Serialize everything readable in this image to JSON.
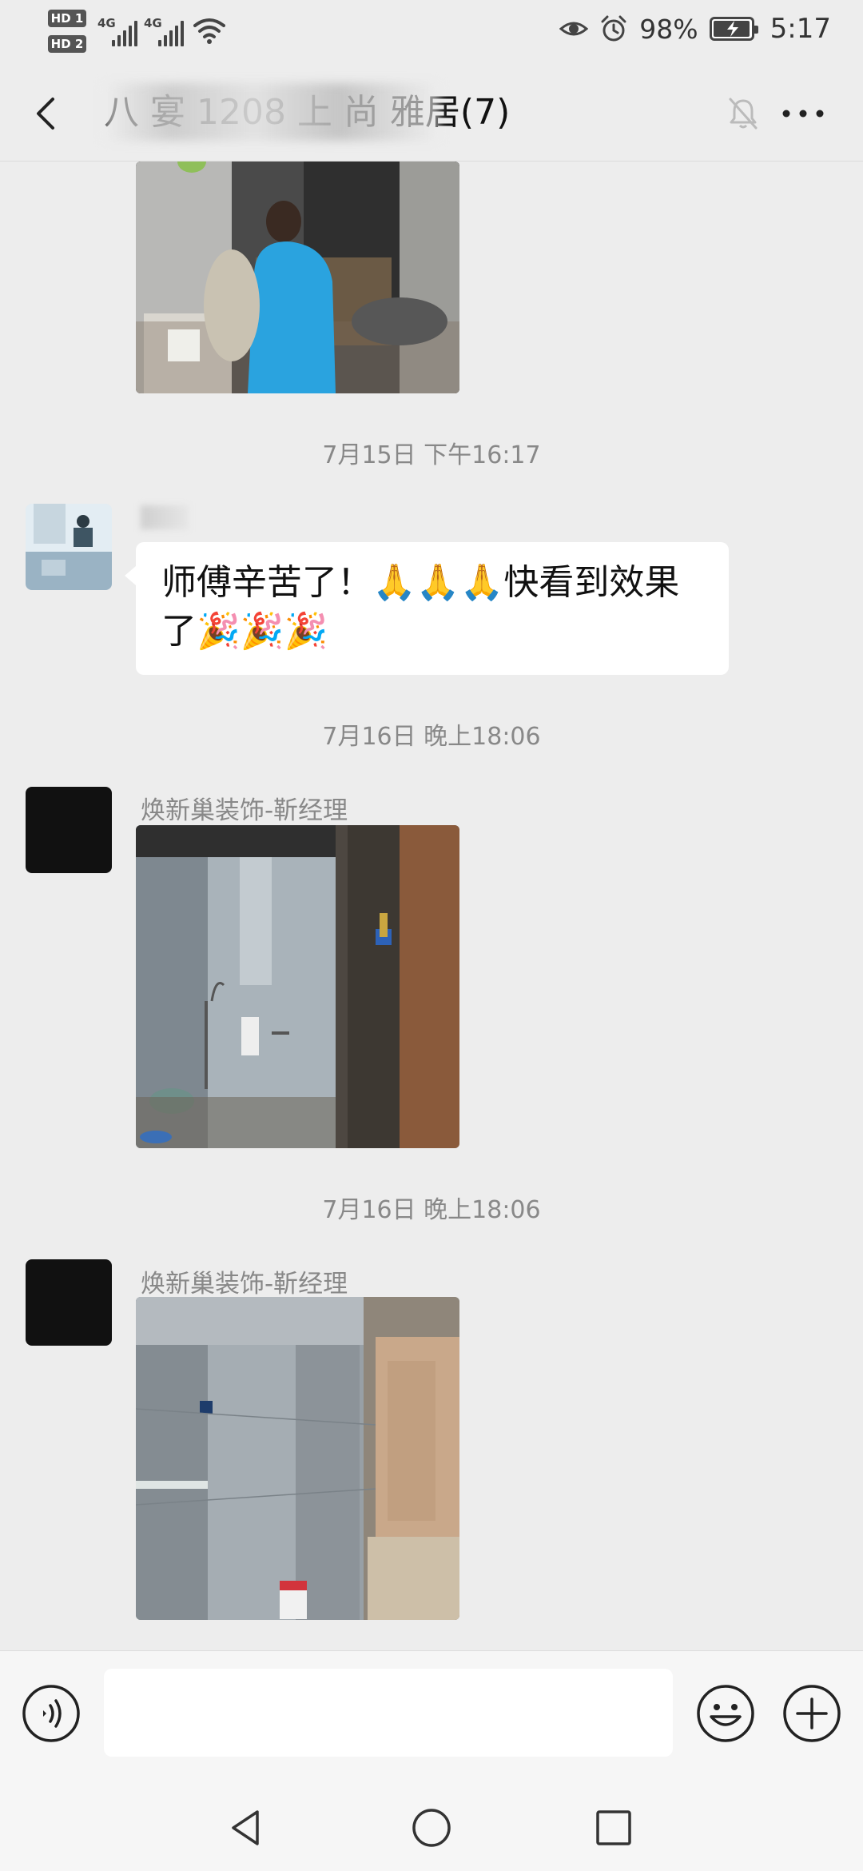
{
  "status_bar": {
    "hd1": "HD 1",
    "hd2": "HD 2",
    "net1": "4G",
    "net2": "4G",
    "battery_percent": "98%",
    "battery_level": 0.98,
    "time": "5:17",
    "icons": [
      "eye-icon",
      "alarm-icon",
      "battery-charging-icon",
      "wifi-icon",
      "signal-icon"
    ]
  },
  "header": {
    "title": "八 宴        1208 上 尚 雅居(7)",
    "icons": [
      "back-icon",
      "mute-bell-icon",
      "more-icon"
    ]
  },
  "messages": [
    {
      "type": "timestamp",
      "text": "7月15日 下午16:17"
    },
    {
      "type": "text",
      "sender": "",
      "text": "师傅辛苦了！🙏🙏🙏快看到效果了🎉🎉🎉"
    },
    {
      "type": "timestamp",
      "text": "7月16日 晚上18:06"
    },
    {
      "type": "image",
      "sender": "焕新巢装饰-靳经理"
    },
    {
      "type": "timestamp",
      "text": "7月16日 晚上18:06"
    },
    {
      "type": "image",
      "sender": "焕新巢装饰-靳经理"
    }
  ],
  "input_bar": {
    "placeholder": "",
    "icons": [
      "voice-icon",
      "emoji-icon",
      "plus-icon"
    ]
  },
  "nav_bar": {
    "icons": [
      "nav-back-icon",
      "nav-home-icon",
      "nav-recents-icon"
    ]
  },
  "colors": {
    "background": "#ededed",
    "bubble": "#ffffff",
    "timestamp": "#888888",
    "input_bar": "#f6f6f6"
  }
}
